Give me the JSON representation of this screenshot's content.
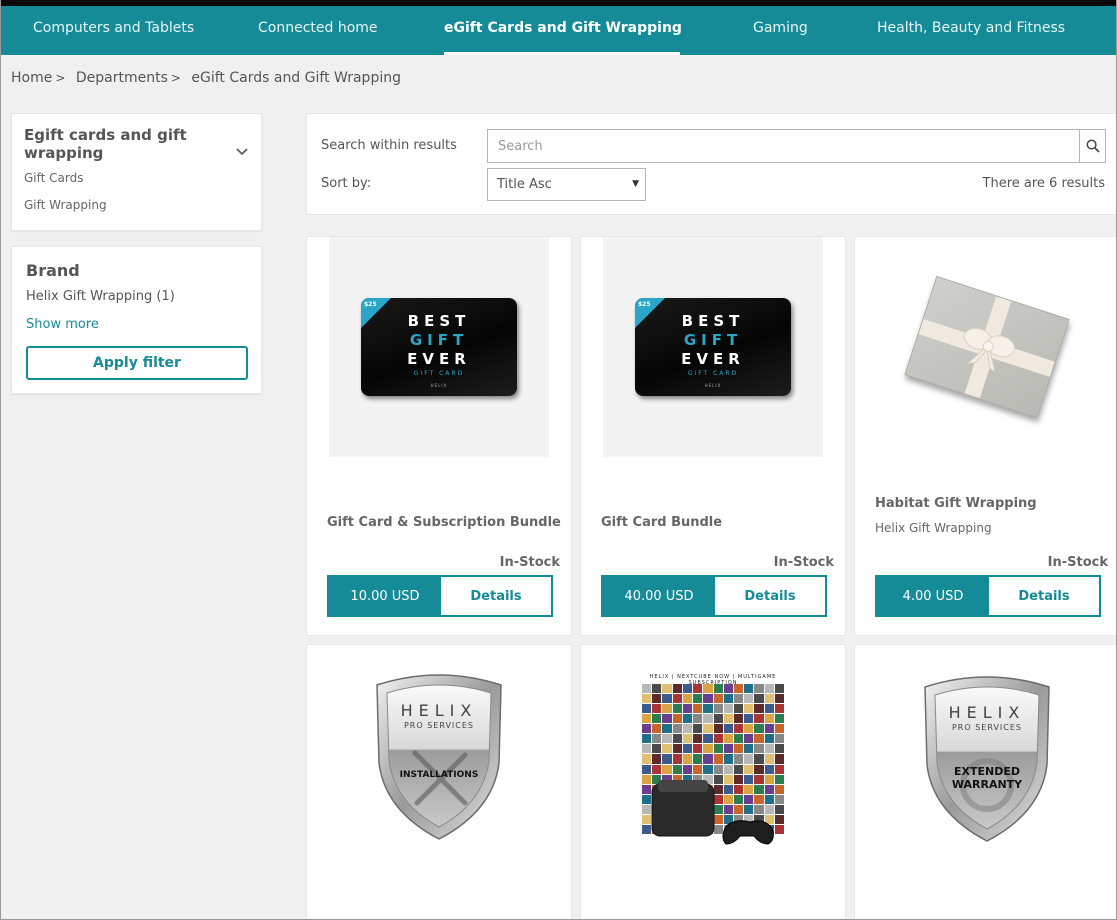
{
  "nav": {
    "items": [
      {
        "label": "Computers and Tablets"
      },
      {
        "label": "Connected home"
      },
      {
        "label": "eGift Cards and Gift Wrapping"
      },
      {
        "label": "Gaming"
      },
      {
        "label": "Health, Beauty and Fitness"
      }
    ],
    "active_index": 2
  },
  "breadcrumb": {
    "home": "Home",
    "departments": "Departments",
    "current": "eGift Cards and Gift Wrapping",
    "separator": ">"
  },
  "categories": {
    "title": "Egift cards and gift wrapping",
    "links": [
      "Gift Cards",
      "Gift Wrapping"
    ]
  },
  "brand_filter": {
    "title": "Brand",
    "option": "Helix Gift Wrapping (1)",
    "show_more": "Show more",
    "apply": "Apply filter"
  },
  "search": {
    "label": "Search within results",
    "placeholder": "Search",
    "sort_label": "Sort by:",
    "sort_value": "Title Asc",
    "results": "There are 6 results"
  },
  "giftcard_art": {
    "tag": "$25",
    "line1": "BEST",
    "line2": "GIFT",
    "line3": "EVER",
    "sub": "GIFT CARD",
    "mini": "HELIX"
  },
  "shield_art": {
    "brand": "HELIX",
    "sub": "PRO SERVICES",
    "installations": "INSTALLATIONS",
    "extended_1": "EXTENDED",
    "extended_2": "WARRANTY"
  },
  "bundle_art": {
    "header": "HELIX | NEXTCUBE NOW | MULTIGAME SUBSCRIPTION"
  },
  "products": [
    {
      "name": "Gift Card & Subscription Bundle",
      "brand": "",
      "stock": "In-Stock",
      "price": "10.00 USD",
      "details": "Details"
    },
    {
      "name": "Gift Card Bundle",
      "brand": "",
      "stock": "In-Stock",
      "price": "40.00 USD",
      "details": "Details"
    },
    {
      "name": "Habitat Gift Wrapping",
      "brand": "Helix Gift Wrapping",
      "stock": "In-Stock",
      "price": "4.00 USD",
      "details": "Details"
    }
  ],
  "colors": {
    "accent": "#168b98",
    "topbar": "#0a0a0a",
    "background": "#f0f0f0"
  }
}
